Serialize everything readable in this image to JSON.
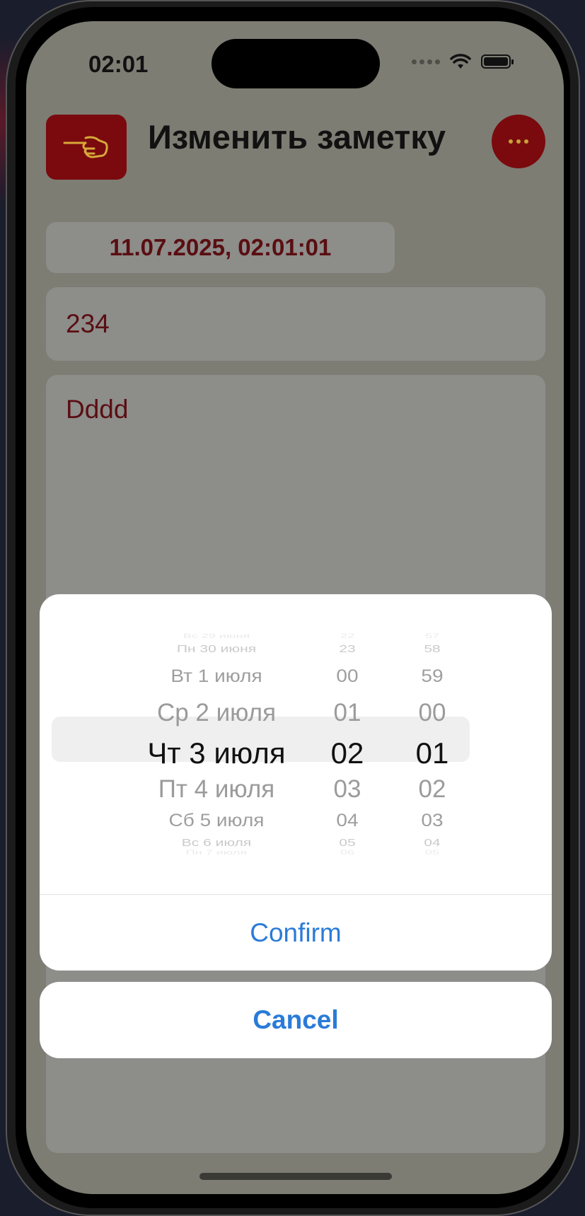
{
  "status_bar": {
    "time": "02:01",
    "wifi_icon": "wifi-icon",
    "battery_icon": "battery-icon"
  },
  "header": {
    "title": "Изменить заметку",
    "back_icon": "pointing-hand-icon",
    "more_icon": "ellipsis-icon"
  },
  "note": {
    "datetime": "11.07.2025, 02:01:01",
    "title_value": "234",
    "body_value": "Dddd"
  },
  "picker": {
    "days": [
      "Вс 29 июня",
      "Пн 30 июня",
      "Вт 1 июля",
      "Ср 2 июля",
      "Чт 3 июля",
      "Пт 4 июля",
      "Сб 5 июля",
      "Вс 6 июля",
      "Пн 7 июля"
    ],
    "hours": [
      "22",
      "23",
      "00",
      "01",
      "02",
      "03",
      "04",
      "05",
      "06"
    ],
    "minutes": [
      "57",
      "58",
      "59",
      "00",
      "01",
      "02",
      "03",
      "04",
      "05"
    ],
    "selected_index": 4
  },
  "actions": {
    "confirm_label": "Confirm",
    "cancel_label": "Cancel"
  },
  "colors": {
    "accent_red": "#7a0a0e",
    "action_blue": "#2a7bd8",
    "overlay": "#7d7d74"
  }
}
